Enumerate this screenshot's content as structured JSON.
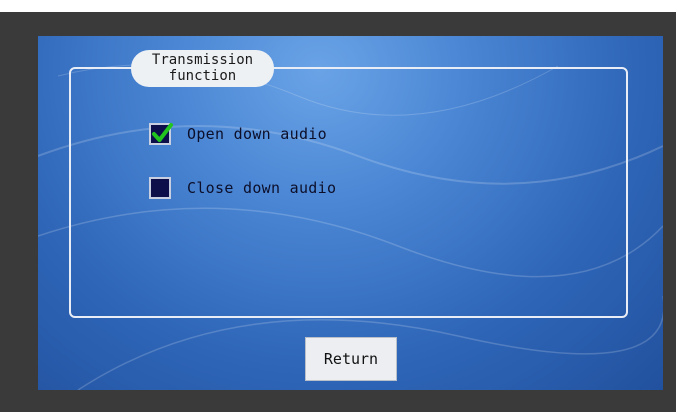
{
  "panel": {
    "group_title_line1": "Transmission",
    "group_title_line2": "function"
  },
  "options": [
    {
      "label": "Open down audio",
      "checked": true
    },
    {
      "label": "Close down audio",
      "checked": false
    }
  ],
  "buttons": {
    "return_label": "Return"
  },
  "colors": {
    "screen_bg": "#3a76c8",
    "checkbox_fill": "#0c0f4a",
    "checkmark": "#22c51e",
    "title_pill": "#eef1f4"
  },
  "icons": {
    "checked": "checkmark-icon"
  }
}
